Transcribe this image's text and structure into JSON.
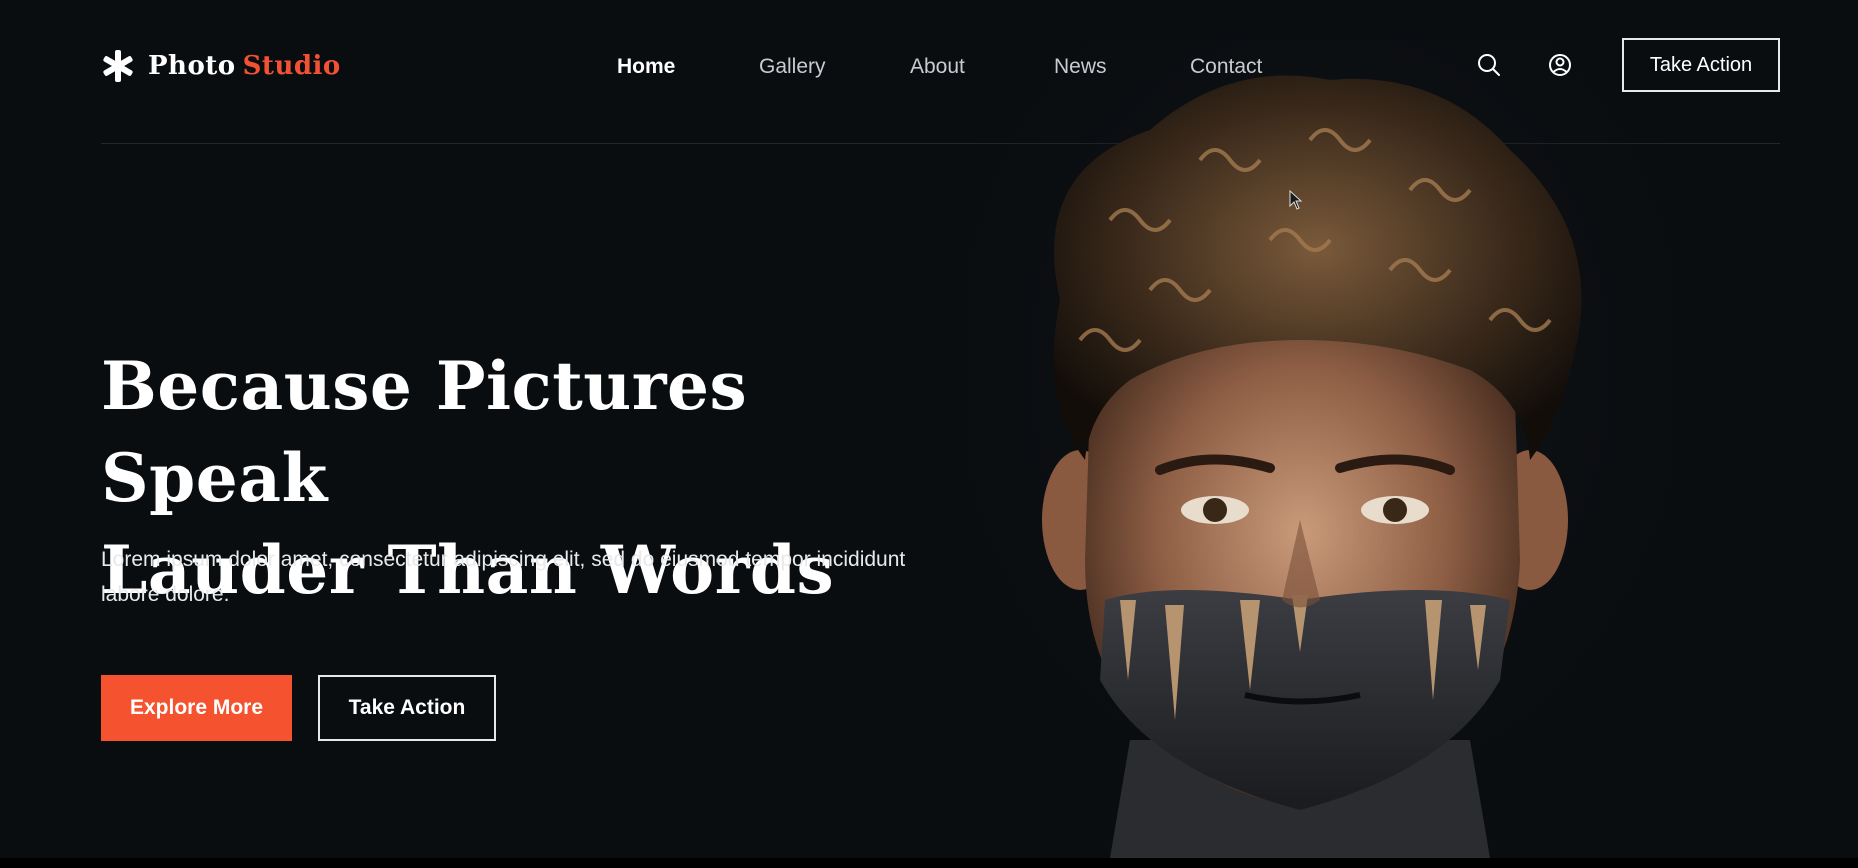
{
  "brand": {
    "name": "Photo",
    "accent": "Studio",
    "icon": "asterisk-icon",
    "accent_color": "#f25233"
  },
  "nav": {
    "items": [
      {
        "label": "Home",
        "active": true
      },
      {
        "label": "Gallery",
        "active": false
      },
      {
        "label": "About",
        "active": false
      },
      {
        "label": "News",
        "active": false
      },
      {
        "label": "Contact",
        "active": false
      }
    ]
  },
  "header": {
    "search_icon": "search-icon",
    "user_icon": "user-circle-icon",
    "cta_label": "Take Action"
  },
  "hero": {
    "title_line1": "Because Pictures Speak",
    "title_line2": "Lauder Than Words",
    "text": "Lorem ipsum dolor amet, consectetur adipiscing elit, sed do eiusmod tempor incididunt labore dolore.",
    "primary_label": "Explore More",
    "secondary_label": "Take Action"
  },
  "colors": {
    "background": "#0a0d10",
    "accent": "#f5532f",
    "text": "#ffffff",
    "muted_nav": "#c8cbd0"
  }
}
